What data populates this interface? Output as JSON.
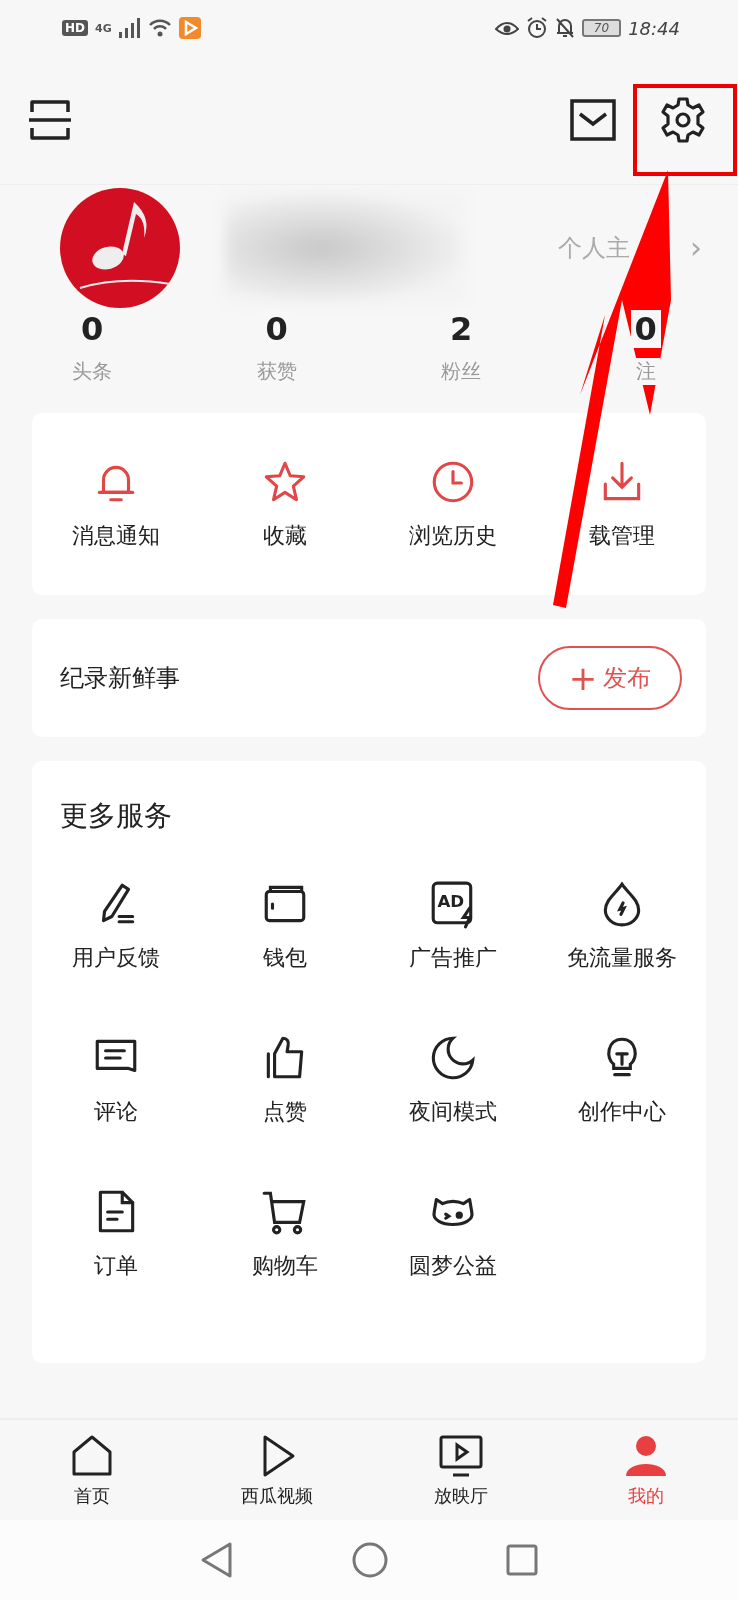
{
  "status_bar": {
    "hd": "HD",
    "network": "4G",
    "battery": "70",
    "time": "18:44"
  },
  "profile": {
    "homepage_link": "个人主",
    "chevron": "›"
  },
  "stats": [
    {
      "value": "0",
      "label": "头条"
    },
    {
      "value": "0",
      "label": "获赞"
    },
    {
      "value": "2",
      "label": "粉丝"
    },
    {
      "value": "0",
      "label": "注"
    }
  ],
  "quick_actions": [
    {
      "label": "消息通知"
    },
    {
      "label": "收藏"
    },
    {
      "label": "浏览历史"
    },
    {
      "label": "载管理"
    }
  ],
  "post_card": {
    "prompt": "纪录新鲜事",
    "button_icon": "+",
    "button_label": "发布"
  },
  "services": {
    "title": "更多服务",
    "items": [
      {
        "label": "用户反馈"
      },
      {
        "label": "钱包"
      },
      {
        "label": "广告推广",
        "icon_text": "AD"
      },
      {
        "label": "免流量服务"
      },
      {
        "label": "评论"
      },
      {
        "label": "点赞"
      },
      {
        "label": "夜间模式"
      },
      {
        "label": "创作中心"
      },
      {
        "label": "订单"
      },
      {
        "label": "购物车"
      },
      {
        "label": "圆梦公益"
      }
    ]
  },
  "bottom_tabs": [
    {
      "label": "首页",
      "selected": false
    },
    {
      "label": "西瓜视频",
      "selected": false
    },
    {
      "label": "放映厅",
      "selected": false
    },
    {
      "label": "我的",
      "selected": true
    }
  ]
}
